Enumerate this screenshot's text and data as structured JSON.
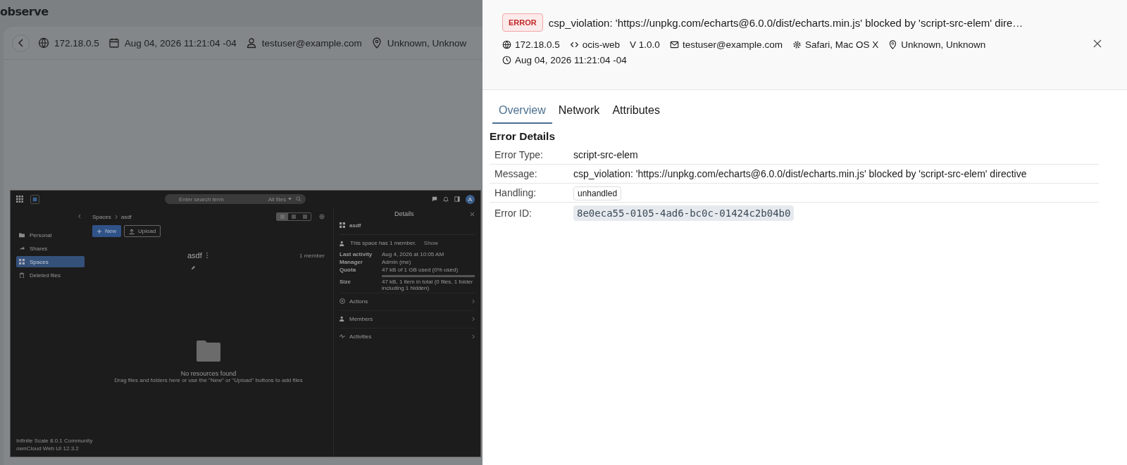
{
  "app": {
    "brand": "observe"
  },
  "session": {
    "ip": "172.18.0.5",
    "date": "Aug 04, 2026 11:21:04 -04",
    "user": "testuser@example.com",
    "location": "Unknown, Unknow"
  },
  "replay": {
    "search_placeholder": "Enter search term",
    "search_filter": "All files",
    "avatar": "A",
    "sidebar": [
      {
        "label": "Personal",
        "selected": false
      },
      {
        "label": "Shares",
        "selected": false
      },
      {
        "label": "Spaces",
        "selected": true
      },
      {
        "label": "Deleted files",
        "selected": false
      }
    ],
    "breadcrumb": [
      "Spaces",
      "asdf"
    ],
    "new_button": "New",
    "upload_button": "Upload",
    "views": [
      {
        "selected": true
      },
      {
        "selected": false
      },
      {
        "selected": false
      }
    ],
    "space_title": "asdf",
    "members": "1 member",
    "empty_title": "No resources found",
    "empty_hint": "Drag files and folders here or use the \"New\" or \"Upload\" buttons to add files",
    "footer": [
      "Infinite Scale 8.0.1 Community",
      "ownCloud Web UI 12.3.2"
    ],
    "details": {
      "title": "Details",
      "space": "asdf",
      "member_note": "This space has 1 member.",
      "show": "Show",
      "props": [
        {
          "label": "Last activity",
          "value": "Aug 4, 2026 at 10:05 AM"
        },
        {
          "label": "Manager",
          "value": "Admin (me)"
        },
        {
          "label": "Quota",
          "value": "47 kB of 1 GB used (0% used)",
          "level": 0
        },
        {
          "label": "Size",
          "value": "47 kB, 1 item in total (0 files, 1 folder including 1 hidden)"
        }
      ],
      "sections": [
        "Actions",
        "Members",
        "Activities"
      ]
    }
  },
  "panel": {
    "badge": "ERROR",
    "title": "csp_violation: 'https://unpkg.com/echarts@6.0.0/dist/echarts.min.js' blocked by 'script-src-elem' dire…",
    "meta": [
      {
        "kind": "globe",
        "text": "172.18.0.5"
      },
      {
        "kind": "code",
        "text": "ocis-web"
      },
      {
        "kind": "plain",
        "text": "V 1.0.0"
      },
      {
        "kind": "mail",
        "text": "testuser@example.com"
      },
      {
        "kind": "gear",
        "text": "Safari, Mac OS X"
      },
      {
        "kind": "pin",
        "text": "Unknown, Unknown"
      }
    ],
    "time": "Aug 04, 2026 11:21:04 -04",
    "tabs": [
      {
        "label": "Overview",
        "selected": true
      },
      {
        "label": "Network",
        "selected": false
      },
      {
        "label": "Attributes",
        "selected": false
      }
    ],
    "section_title": "Error Details",
    "rows": [
      {
        "label": "Error Type:",
        "kind": "text",
        "value": "script-src-elem"
      },
      {
        "label": "Message:",
        "kind": "text",
        "value": "csp_violation: 'https://unpkg.com/echarts@6.0.0/dist/echarts.min.js' blocked by 'script-src-elem' directive"
      },
      {
        "label": "Handling:",
        "kind": "tag",
        "value": "unhandled"
      },
      {
        "label": "Error ID:",
        "kind": "code",
        "value": "8e0eca55-0105-4ad6-bc0c-01424c2b04b0"
      }
    ]
  }
}
